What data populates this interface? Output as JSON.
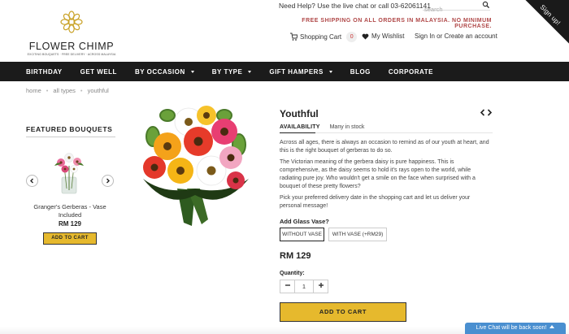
{
  "header": {
    "logo_name": "FLOWER CHIMP",
    "logo_tagline": "EXCITING BOUQUETS · FREE DELIVERY · ACROSS MALAYSIA",
    "help_text": "Need Help? Use the live chat or call 03-62061141",
    "search_placeholder": "search",
    "promo": "FREE SHIPPING ON ALL ORDERS IN MALAYSIA. NO MINIMUM PURCHASE.",
    "cart_label": "Shopping Cart",
    "cart_count": "0",
    "wishlist_label": "My Wishlist",
    "account_label": "Sign In or Create an account",
    "ribbon": "Sign up!"
  },
  "nav": {
    "items": [
      {
        "label": "BIRTHDAY",
        "dropdown": false
      },
      {
        "label": "GET WELL",
        "dropdown": false
      },
      {
        "label": "BY OCCASION",
        "dropdown": true
      },
      {
        "label": "BY TYPE",
        "dropdown": true
      },
      {
        "label": "GIFT HAMPERS",
        "dropdown": true
      },
      {
        "label": "BLOG",
        "dropdown": false
      },
      {
        "label": "CORPORATE",
        "dropdown": false
      }
    ]
  },
  "breadcrumb": [
    "home",
    "all types",
    "youthful"
  ],
  "featured": {
    "title": "FEATURED BOUQUETS",
    "item_name": "Granger's Gerberas - Vase Included",
    "item_price": "RM 129",
    "add_to_cart": "ADD TO CART"
  },
  "product": {
    "title": "Youthful",
    "availability_label": "AVAILABILITY",
    "availability_value": "Many in stock",
    "description": [
      "Across all ages, there is always an occasion to remind as of our youth at heart, and this is the right bouquet of gerberas to do so.",
      "The Victorian meaning of the gerbera daisy is pure happiness. This is comprehensive, as the daisy seems to hold it's rays open to the world, while radiating pure joy. Who wouldn't get a smile on the face when surprised with a bouquet of these pretty flowers?",
      "Pick your preferred delivery date in the shopping cart and let us deliver your personal message!"
    ],
    "vase_label": "Add Glass Vase?",
    "vase_options": [
      "WITHOUT VASE",
      "WITH VASE (+RM29)"
    ],
    "vase_selected": "WITHOUT VASE",
    "price": "RM 129",
    "quantity_label": "Quantity:",
    "quantity": "1",
    "add_to_cart": "ADD TO CART"
  },
  "chat": {
    "label": "Live Chat will be back soon!"
  },
  "colors": {
    "accent_yellow": "#e6b92d",
    "nav_bg": "#1b1b1b",
    "promo_red": "#b04848",
    "chat_blue": "#4a8fd0",
    "logo_gold": "#c9a227"
  }
}
